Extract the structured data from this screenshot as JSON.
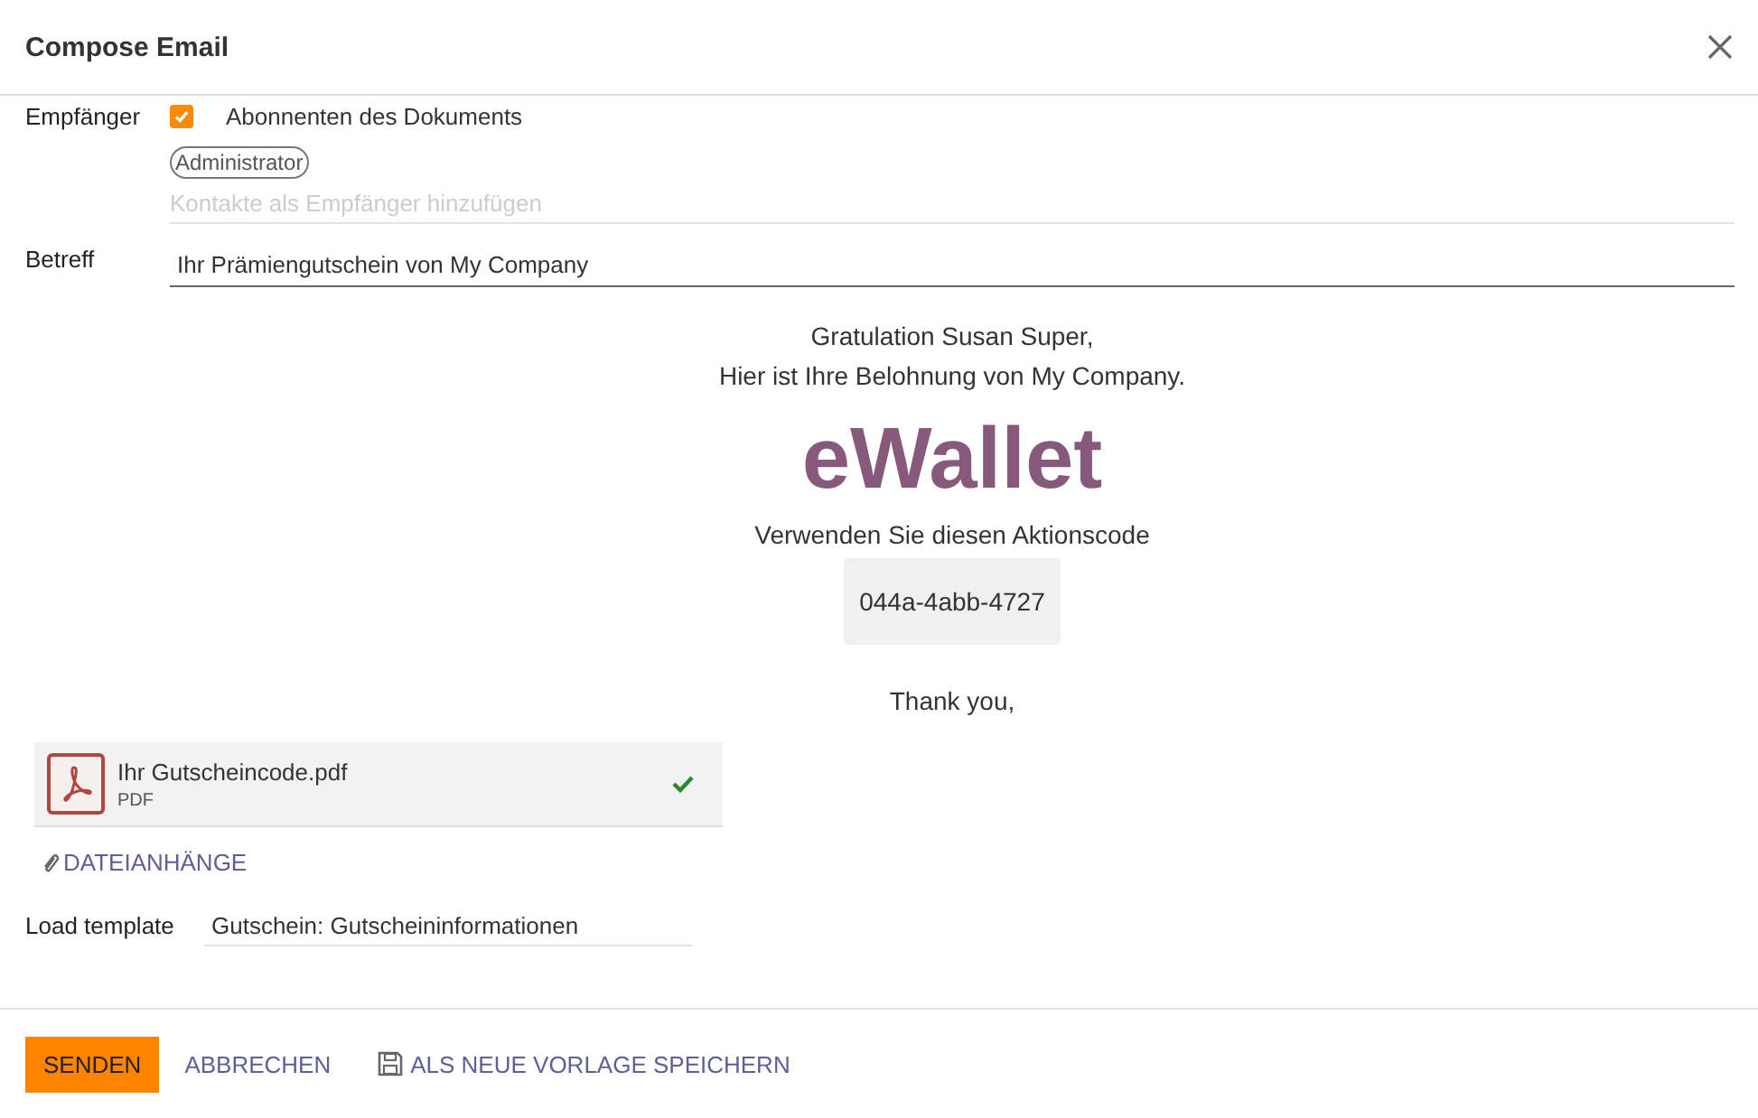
{
  "dialog": {
    "title": "Compose Email"
  },
  "recipients": {
    "label": "Empfänger",
    "followers_checked": true,
    "followers_label": "Abonnenten des Dokuments",
    "tags": [
      "Administrator"
    ],
    "placeholder": "Kontakte als Empfänger hinzufügen"
  },
  "subject": {
    "label": "Betreff",
    "value": "Ihr Prämiengutschein von My Company"
  },
  "body": {
    "greeting": "Gratulation Susan Super,",
    "intro": "Hier ist Ihre Belohnung von My Company.",
    "headline": "eWallet",
    "code_label": "Verwenden Sie diesen Aktionscode",
    "code": "044a-4abb-4727",
    "closing": "Thank you,"
  },
  "attachments": [
    {
      "name": "Ihr Gutscheincode.pdf",
      "type": "PDF",
      "uploaded": true
    }
  ],
  "attach_button": "DATEIANHÄNGE",
  "template": {
    "label": "Load template",
    "value": "Gutschein: Gutscheininformationen"
  },
  "footer": {
    "send": "SENDEN",
    "cancel": "ABBRECHEN",
    "save_template": "ALS NEUE VORLAGE SPEICHERN"
  }
}
